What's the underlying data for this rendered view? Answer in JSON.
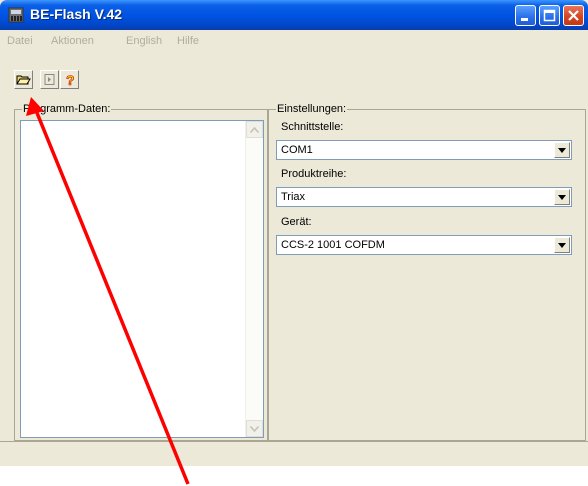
{
  "window": {
    "title": "BE-Flash V.42"
  },
  "menu": {
    "items": [
      "Datei",
      "Aktionen",
      "English",
      "Hilfe"
    ]
  },
  "toolbar": {
    "open_icon": "folder-open-icon",
    "next_icon": "step-icon",
    "help_icon": "help-icon",
    "help_glyph": "?"
  },
  "left_panel": {
    "label": "Programm-Daten:"
  },
  "right_panel": {
    "label": "Einstellungen:",
    "interface": {
      "label": "Schnittstelle:",
      "value": "COM1"
    },
    "product_line": {
      "label": "Produktreihe:",
      "value": "Triax"
    },
    "device": {
      "label": "Gerät:",
      "value": "CCS-2 1001  COFDM"
    }
  },
  "colors": {
    "annotation_arrow": "#ff0000",
    "titlebar": "#0054e3",
    "window_bg": "#ece9d8"
  }
}
